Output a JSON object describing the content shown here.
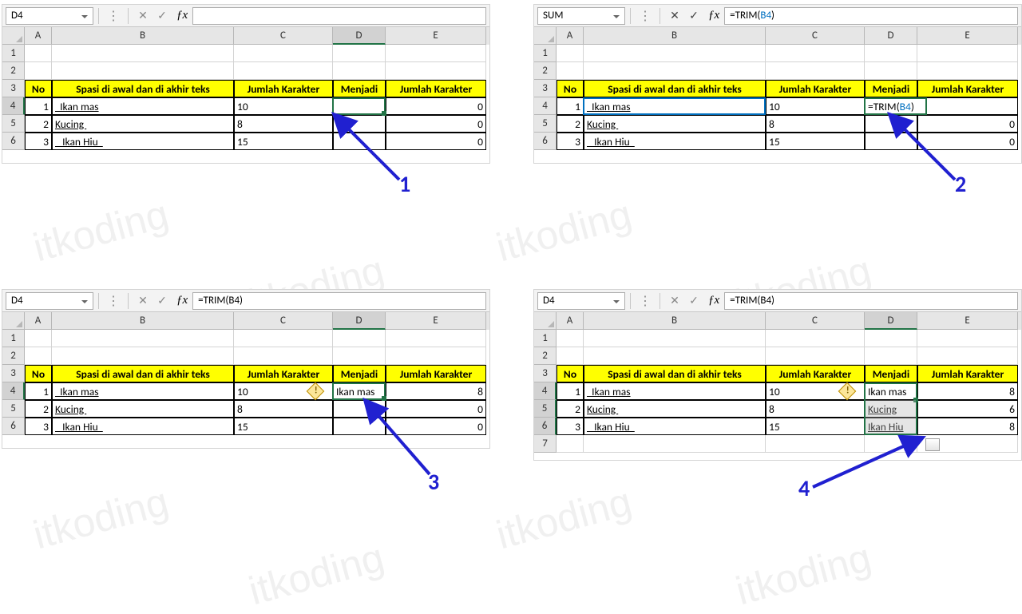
{
  "watermark": "itkoding",
  "panels": {
    "p1": {
      "cell_ref": "D4",
      "formula": "",
      "headers": {
        "no": "No",
        "text": "Spasi di awal dan di akhir teks",
        "len": "Jumlah Karakter",
        "res": "Menjadi",
        "len2": "Jumlah Karakter"
      },
      "rows": [
        {
          "no": "1",
          "text": "  Ikan mas",
          "len": "10",
          "res": "",
          "len2": "0"
        },
        {
          "no": "2",
          "text": "Kucing ",
          "len": "8",
          "res": "",
          "len2": "0"
        },
        {
          "no": "3",
          "text": "   Ikan Hiu  ",
          "len": "15",
          "res": "",
          "len2": "0"
        }
      ],
      "step": "1"
    },
    "p2": {
      "cell_ref": "SUM",
      "formula_pre": "=TRIM(",
      "formula_ref": "B4",
      "formula_post": ")",
      "edit_pre": "=TRIM(",
      "edit_ref": "B4",
      "edit_post": ")",
      "headers": {
        "no": "No",
        "text": "Spasi di awal dan di akhir teks",
        "len": "Jumlah Karakter",
        "res": "Menjadi",
        "len2": "Jumlah Karakter"
      },
      "rows": [
        {
          "no": "1",
          "text": "  Ikan mas",
          "len": "10",
          "res": "",
          "len2": ""
        },
        {
          "no": "2",
          "text": "Kucing ",
          "len": "8",
          "res": "",
          "len2": "0"
        },
        {
          "no": "3",
          "text": "   Ikan Hiu  ",
          "len": "15",
          "res": "",
          "len2": "0"
        }
      ],
      "step": "2"
    },
    "p3": {
      "cell_ref": "D4",
      "formula": "=TRIM(B4)",
      "headers": {
        "no": "No",
        "text": "Spasi di awal dan di akhir teks",
        "len": "Jumlah Karakter",
        "res": "Menjadi",
        "len2": "Jumlah Karakter"
      },
      "rows": [
        {
          "no": "1",
          "text": "  Ikan mas",
          "len": "10",
          "res": "Ikan mas",
          "len2": "8"
        },
        {
          "no": "2",
          "text": "Kucing ",
          "len": "8",
          "res": "",
          "len2": "0"
        },
        {
          "no": "3",
          "text": "   Ikan Hiu  ",
          "len": "15",
          "res": "",
          "len2": "0"
        }
      ],
      "step": "3"
    },
    "p4": {
      "cell_ref": "D4",
      "formula": "=TRIM(B4)",
      "headers": {
        "no": "No",
        "text": "Spasi di awal dan di akhir teks",
        "len": "Jumlah Karakter",
        "res": "Menjadi",
        "len2": "Jumlah Karakter"
      },
      "rows": [
        {
          "no": "1",
          "text": "  Ikan mas",
          "len": "10",
          "res": "Ikan mas",
          "len2": "8"
        },
        {
          "no": "2",
          "text": "Kucing ",
          "len": "8",
          "res": "Kucing",
          "len2": "6"
        },
        {
          "no": "3",
          "text": "   Ikan Hiu  ",
          "len": "15",
          "res": "Ikan Hiu",
          "len2": "8"
        }
      ],
      "step": "4"
    }
  },
  "cols": {
    "A": "A",
    "B": "B",
    "C": "C",
    "D": "D",
    "E": "E"
  }
}
